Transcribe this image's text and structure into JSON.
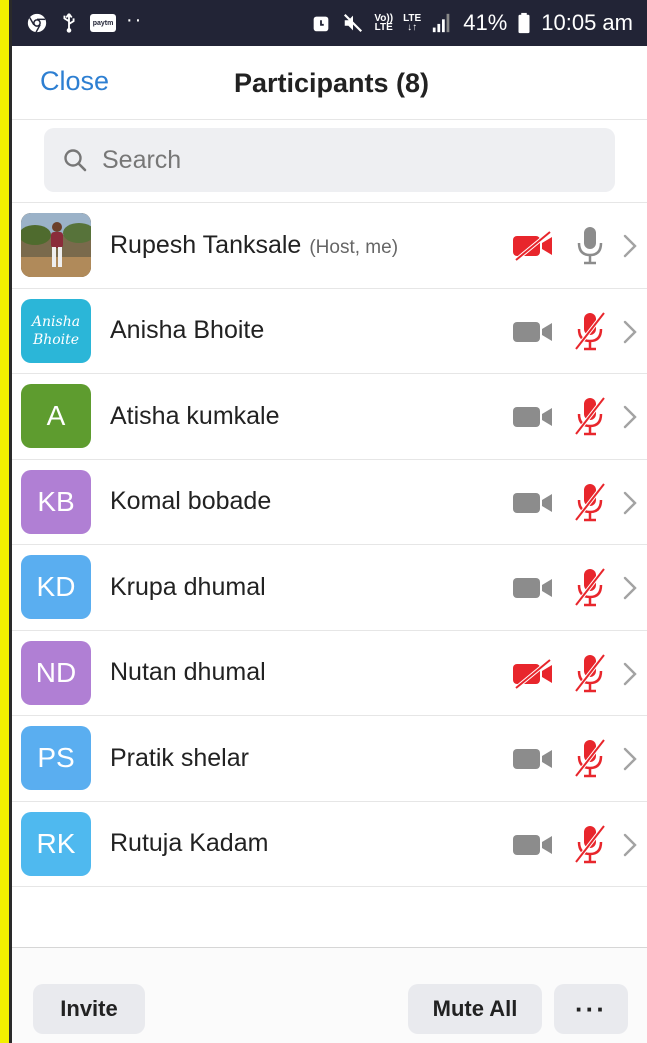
{
  "status_bar": {
    "battery": "41%",
    "time": "10:05 am",
    "volte_line1": "Vo))",
    "volte_line2": "LTE",
    "lte_line1": "LTE",
    "lte_line2": "↓↑",
    "paytm": "paytm"
  },
  "header": {
    "close_label": "Close",
    "title": "Participants (8)"
  },
  "search": {
    "placeholder": "Search"
  },
  "participants": [
    {
      "name": "Rupesh Tanksale",
      "tag": "(Host, me)",
      "initials": "",
      "avatar_type": "photo",
      "avatar_color": "#8a6d4a",
      "video": "off",
      "audio": "on"
    },
    {
      "name": "Anisha Bhoite",
      "tag": "",
      "initials": "",
      "avatar_type": "image-text",
      "avatar_line1": "Anisha",
      "avatar_line2": "Bhoite",
      "avatar_color": "#2bb6d8",
      "video": "on",
      "audio": "muted"
    },
    {
      "name": "Atisha kumkale",
      "tag": "",
      "initials": "A",
      "avatar_type": "initials",
      "avatar_color": "#5e9c2f",
      "video": "on",
      "audio": "muted"
    },
    {
      "name": "Komal bobade",
      "tag": "",
      "initials": "KB",
      "avatar_type": "initials",
      "avatar_color": "#b07fd4",
      "video": "on",
      "audio": "muted"
    },
    {
      "name": "Krupa dhumal",
      "tag": "",
      "initials": "KD",
      "avatar_type": "initials",
      "avatar_color": "#5aaef0",
      "video": "on",
      "audio": "muted"
    },
    {
      "name": "Nutan dhumal",
      "tag": "",
      "initials": "ND",
      "avatar_type": "initials",
      "avatar_color": "#b07fd4",
      "video": "off",
      "audio": "muted"
    },
    {
      "name": "Pratik shelar",
      "tag": "",
      "initials": "PS",
      "avatar_type": "initials",
      "avatar_color": "#5aaef0",
      "video": "on",
      "audio": "muted"
    },
    {
      "name": "Rutuja Kadam",
      "tag": "",
      "initials": "RK",
      "avatar_type": "initials",
      "avatar_color": "#4fb9ef",
      "video": "on",
      "audio": "muted"
    }
  ],
  "footer": {
    "invite_label": "Invite",
    "mute_all_label": "Mute All",
    "more_label": "···"
  },
  "colors": {
    "accent": "#2d7fd2",
    "muted_red": "#e8262c",
    "icon_gray": "#8c8c8c"
  },
  "icons": [
    "chrome-icon",
    "usb-icon",
    "paytm-icon",
    "alarm-icon",
    "mute-icon",
    "signal-icon",
    "battery-icon",
    "search-icon",
    "video-icon",
    "video-off-icon",
    "mic-icon",
    "mic-off-icon",
    "chevron-right-icon"
  ]
}
